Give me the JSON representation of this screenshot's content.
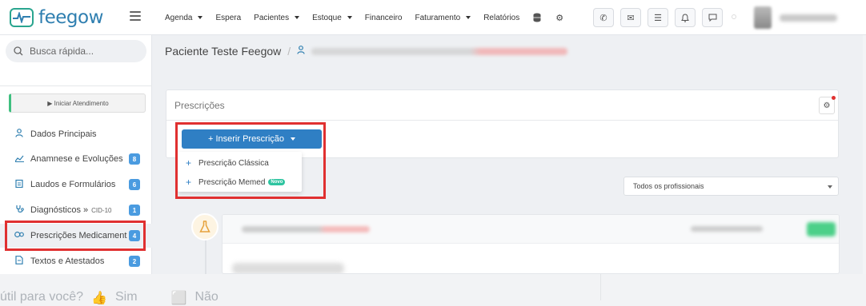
{
  "app": {
    "logo_text": "feegow"
  },
  "nav": {
    "items": [
      {
        "label": "Agenda",
        "dropdown": true
      },
      {
        "label": "Espera",
        "dropdown": false
      },
      {
        "label": "Pacientes",
        "dropdown": true
      },
      {
        "label": "Estoque",
        "dropdown": true
      },
      {
        "label": "Financeiro",
        "dropdown": false
      },
      {
        "label": "Faturamento",
        "dropdown": true
      },
      {
        "label": "Relatórios",
        "dropdown": false
      }
    ],
    "extra_icons": [
      "database-icon",
      "gear-icon"
    ],
    "tool_icons": [
      "phone-icon",
      "inbox-icon",
      "checklist-icon",
      "bell-icon",
      "chat-icon"
    ]
  },
  "sidebar": {
    "search_placeholder": "Busca rápida...",
    "start_button": "▶ Iniciar Atendimento",
    "items": [
      {
        "label": "Dados Principais",
        "icon": "user-icon",
        "badge": ""
      },
      {
        "label": "Anamnese e Evoluções",
        "icon": "chart-icon",
        "badge": "8"
      },
      {
        "label": "Laudos e Formulários",
        "icon": "clipboard-icon",
        "badge": "6"
      },
      {
        "label": "Diagnósticos » ",
        "small": "CID-10",
        "icon": "stethoscope-icon",
        "badge": "1"
      },
      {
        "label": "Prescrições Medicament",
        "icon": "pills-icon",
        "badge": "4"
      },
      {
        "label": "Textos e Atestados",
        "icon": "document-icon",
        "badge": "2"
      }
    ]
  },
  "breadcrumb": {
    "title": "Paciente Teste Feegow",
    "separator": "/"
  },
  "panel": {
    "title": "Prescrições",
    "insert_button": "+ Inserir Prescrição",
    "dropdown": [
      {
        "label": "Prescrição Clássica",
        "tag": ""
      },
      {
        "label": "Prescrição Memed",
        "tag": "Novo"
      }
    ]
  },
  "filter": {
    "selected": "Todos os profissionais"
  },
  "footer": {
    "question": "útil para você?",
    "yes": "Sim",
    "no": "Não"
  },
  "colors": {
    "accent": "#2f7fc4",
    "brand": "#2f7fb0",
    "highlight_border": "#e03030",
    "badge": "#4a9be0",
    "novo": "#2ec4a0"
  }
}
